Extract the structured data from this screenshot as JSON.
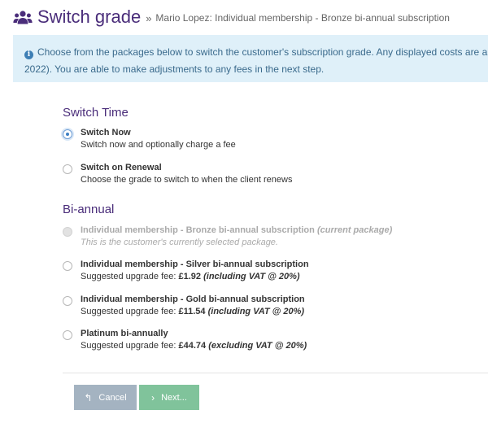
{
  "header": {
    "title": "Switch grade",
    "breadcrumb_sep": "»",
    "breadcrumb": "Mario Lopez: Individual membership - Bronze bi-annual subscription",
    "icon": "users-icon"
  },
  "info": {
    "icon": "info-icon",
    "line1": "Choose from the packages below to switch the customer's subscription grade. Any displayed costs are an estimate",
    "line2": "2022). You are able to make adjustments to any fees in the next step."
  },
  "switch_time": {
    "heading": "Switch Time",
    "options": [
      {
        "title": "Switch Now",
        "desc": "Switch now and optionally charge a fee",
        "selected": true
      },
      {
        "title": "Switch on Renewal",
        "desc": "Choose the grade to switch to when the client renews",
        "selected": false
      }
    ]
  },
  "biannual": {
    "heading": "Bi-annual",
    "current": {
      "title": "Individual membership - Bronze bi-annual subscription",
      "tag": "(current package)",
      "desc": "This is the customer's currently selected package."
    },
    "packages": [
      {
        "title": "Individual membership - Silver bi-annual subscription",
        "fee_label": "Suggested upgrade fee:",
        "fee": "£1.92",
        "vat": "(including VAT @ 20%)"
      },
      {
        "title": "Individual membership - Gold bi-annual subscription",
        "fee_label": "Suggested upgrade fee:",
        "fee": "£11.54",
        "vat": "(including VAT @ 20%)"
      },
      {
        "title": "Platinum bi-annually",
        "fee_label": "Suggested upgrade fee:",
        "fee": "£44.74",
        "vat": "(excluding VAT @ 20%)"
      }
    ]
  },
  "buttons": {
    "cancel": "Cancel",
    "next": "Next..."
  },
  "colors": {
    "title": "#4a2d7a",
    "info_bg": "#dff0f9",
    "cancel_bg": "#a4b3c1",
    "next_bg": "#80c39b"
  }
}
